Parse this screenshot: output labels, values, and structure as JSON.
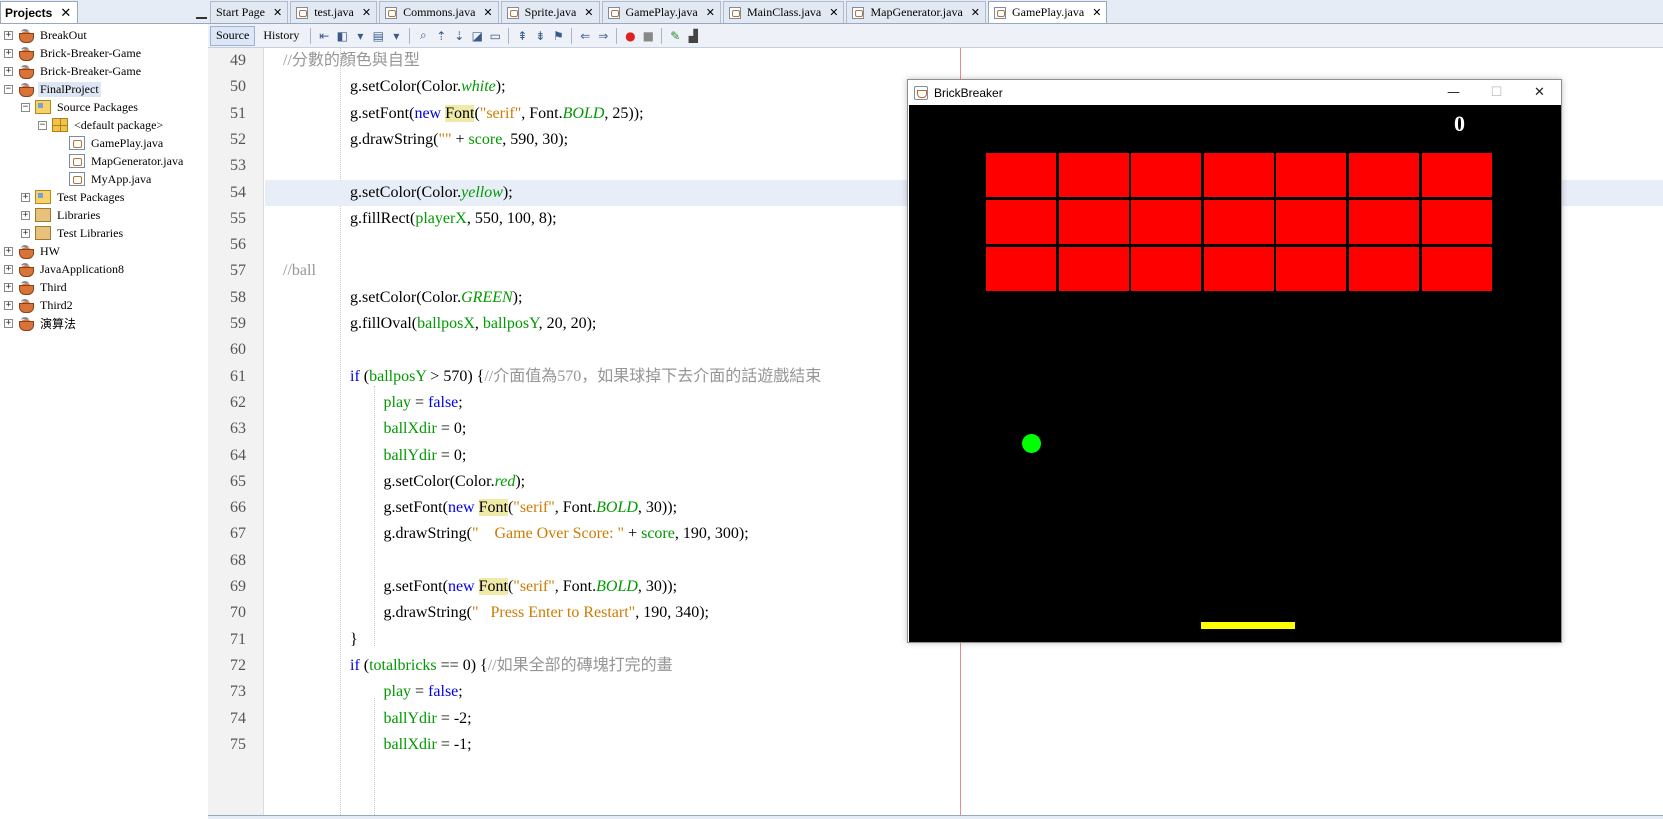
{
  "projects": {
    "tab_label": "Projects",
    "close_glyph": "✕",
    "nodes": [
      {
        "label": "BreakOut",
        "icon": "project-icon",
        "expander": "+"
      },
      {
        "label": "Brick-Breaker-Game",
        "icon": "project-icon",
        "expander": "+"
      },
      {
        "label": "Brick-Breaker-Game",
        "icon": "project-icon",
        "expander": "+"
      },
      {
        "label": "FinalProject",
        "icon": "project-icon",
        "expander": "−"
      },
      {
        "label": "Source Packages",
        "icon": "source-packages-icon",
        "expander": "−"
      },
      {
        "label": "<default package>",
        "icon": "package-icon",
        "expander": "−"
      },
      {
        "label": "GamePlay.java",
        "icon": "java-file-icon",
        "expander": ""
      },
      {
        "label": "MapGenerator.java",
        "icon": "java-file-icon",
        "expander": ""
      },
      {
        "label": "MyApp.java",
        "icon": "java-file-icon",
        "expander": ""
      },
      {
        "label": "Test Packages",
        "icon": "test-packages-icon",
        "expander": "+"
      },
      {
        "label": "Libraries",
        "icon": "libraries-icon",
        "expander": "+"
      },
      {
        "label": "Test Libraries",
        "icon": "test-libraries-icon",
        "expander": "+"
      },
      {
        "label": "HW",
        "icon": "project-icon",
        "expander": "+"
      },
      {
        "label": "JavaApplication8",
        "icon": "project-icon",
        "expander": "+"
      },
      {
        "label": "Third",
        "icon": "project-icon",
        "expander": "+"
      },
      {
        "label": "Third2",
        "icon": "project-icon",
        "expander": "+"
      },
      {
        "label": "演算法",
        "icon": "project-icon",
        "expander": "+"
      }
    ]
  },
  "editor": {
    "tabs": [
      {
        "label": "Start Page",
        "icon": ""
      },
      {
        "label": "test.java",
        "icon": "java-file-icon"
      },
      {
        "label": "Commons.java",
        "icon": "java-file-icon"
      },
      {
        "label": "Sprite.java",
        "icon": "java-file-icon"
      },
      {
        "label": "GamePlay.java",
        "icon": "java-file-icon"
      },
      {
        "label": "MainClass.java",
        "icon": "java-file-icon"
      },
      {
        "label": "MapGenerator.java",
        "icon": "java-file-icon"
      },
      {
        "label": "GamePlay.java",
        "icon": "java-file-icon"
      }
    ],
    "tab_close_glyph": "✕",
    "active_tab_index": 7,
    "toolbar": {
      "source_label": "Source",
      "history_label": "History"
    },
    "lines": [
      {
        "num": "49",
        "indent": 0,
        "segments": [
          {
            "t": "//分數的顏色與自型",
            "c": "cm"
          }
        ]
      },
      {
        "num": "50",
        "indent": 2,
        "segments": [
          {
            "t": "g.setColor(Color.",
            "c": "n"
          },
          {
            "t": "white",
            "c": "st"
          },
          {
            "t": ");",
            "c": "n"
          }
        ]
      },
      {
        "num": "51",
        "indent": 2,
        "segments": [
          {
            "t": "g.setFont(",
            "c": "n"
          },
          {
            "t": "new",
            "c": "kw"
          },
          {
            "t": " ",
            "c": "n"
          },
          {
            "t": "Font",
            "c": "hl"
          },
          {
            "t": "(",
            "c": "n"
          },
          {
            "t": "\"serif\"",
            "c": "s"
          },
          {
            "t": ", Font.",
            "c": "n"
          },
          {
            "t": "BOLD",
            "c": "st"
          },
          {
            "t": ", 25));",
            "c": "n"
          }
        ]
      },
      {
        "num": "52",
        "indent": 2,
        "segments": [
          {
            "t": "g.drawString(",
            "c": "n"
          },
          {
            "t": "\"\"",
            "c": "s"
          },
          {
            "t": " + ",
            "c": "n"
          },
          {
            "t": "score",
            "c": "f"
          },
          {
            "t": ", 590, 30);",
            "c": "n"
          }
        ]
      },
      {
        "num": "53",
        "indent": 0,
        "segments": []
      },
      {
        "num": "54",
        "indent": 2,
        "segments": [
          {
            "t": "g.setColor(Color.",
            "c": "n"
          },
          {
            "t": "yellow",
            "c": "st"
          },
          {
            "t": ");",
            "c": "n"
          }
        ],
        "current": true
      },
      {
        "num": "55",
        "indent": 2,
        "segments": [
          {
            "t": "g.fillRect(",
            "c": "n"
          },
          {
            "t": "playerX",
            "c": "f"
          },
          {
            "t": ", 550, 100, 8);",
            "c": "n"
          }
        ]
      },
      {
        "num": "56",
        "indent": 0,
        "segments": []
      },
      {
        "num": "57",
        "indent": 0,
        "segments": [
          {
            "t": "//ball",
            "c": "cm"
          }
        ]
      },
      {
        "num": "58",
        "indent": 2,
        "segments": [
          {
            "t": "g.setColor(Color.",
            "c": "n"
          },
          {
            "t": "GREEN",
            "c": "st"
          },
          {
            "t": ");",
            "c": "n"
          }
        ]
      },
      {
        "num": "59",
        "indent": 2,
        "segments": [
          {
            "t": "g.fillOval(",
            "c": "n"
          },
          {
            "t": "ballposX",
            "c": "f"
          },
          {
            "t": ", ",
            "c": "n"
          },
          {
            "t": "ballposY",
            "c": "f"
          },
          {
            "t": ", 20, 20);",
            "c": "n"
          }
        ]
      },
      {
        "num": "60",
        "indent": 0,
        "segments": []
      },
      {
        "num": "61",
        "indent": 2,
        "segments": [
          {
            "t": "if",
            "c": "kw"
          },
          {
            "t": " (",
            "c": "n"
          },
          {
            "t": "ballposY",
            "c": "f"
          },
          {
            "t": " > 570) {",
            "c": "n"
          },
          {
            "t": "//介面值為570，如果球掉下去介面的話遊戲結束",
            "c": "cm"
          }
        ]
      },
      {
        "num": "62",
        "indent": 3,
        "segments": [
          {
            "t": "play",
            "c": "f"
          },
          {
            "t": " = ",
            "c": "n"
          },
          {
            "t": "false",
            "c": "kw"
          },
          {
            "t": ";",
            "c": "n"
          }
        ]
      },
      {
        "num": "63",
        "indent": 3,
        "segments": [
          {
            "t": "ballXdir",
            "c": "f"
          },
          {
            "t": " = 0;",
            "c": "n"
          }
        ]
      },
      {
        "num": "64",
        "indent": 3,
        "segments": [
          {
            "t": "ballYdir",
            "c": "f"
          },
          {
            "t": " = 0;",
            "c": "n"
          }
        ]
      },
      {
        "num": "65",
        "indent": 3,
        "segments": [
          {
            "t": "g.setColor(Color.",
            "c": "n"
          },
          {
            "t": "red",
            "c": "st"
          },
          {
            "t": ");",
            "c": "n"
          }
        ]
      },
      {
        "num": "66",
        "indent": 3,
        "segments": [
          {
            "t": "g.setFont(",
            "c": "n"
          },
          {
            "t": "new",
            "c": "kw"
          },
          {
            "t": " ",
            "c": "n"
          },
          {
            "t": "Font",
            "c": "hl"
          },
          {
            "t": "(",
            "c": "n"
          },
          {
            "t": "\"serif\"",
            "c": "s"
          },
          {
            "t": ", Font.",
            "c": "n"
          },
          {
            "t": "BOLD",
            "c": "st"
          },
          {
            "t": ", 30));",
            "c": "n"
          }
        ]
      },
      {
        "num": "67",
        "indent": 3,
        "segments": [
          {
            "t": "g.drawString(",
            "c": "n"
          },
          {
            "t": "\"    Game Over Score: \"",
            "c": "s"
          },
          {
            "t": " + ",
            "c": "n"
          },
          {
            "t": "score",
            "c": "f"
          },
          {
            "t": ", 190, 300);",
            "c": "n"
          }
        ]
      },
      {
        "num": "68",
        "indent": 0,
        "segments": []
      },
      {
        "num": "69",
        "indent": 3,
        "segments": [
          {
            "t": "g.setFont(",
            "c": "n"
          },
          {
            "t": "new",
            "c": "kw"
          },
          {
            "t": " ",
            "c": "n"
          },
          {
            "t": "Font",
            "c": "hl"
          },
          {
            "t": "(",
            "c": "n"
          },
          {
            "t": "\"serif\"",
            "c": "s"
          },
          {
            "t": ", Font.",
            "c": "n"
          },
          {
            "t": "BOLD",
            "c": "st"
          },
          {
            "t": ", 30));",
            "c": "n"
          }
        ]
      },
      {
        "num": "70",
        "indent": 3,
        "segments": [
          {
            "t": "g.drawString(",
            "c": "n"
          },
          {
            "t": "\"   Press Enter to Restart\"",
            "c": "s"
          },
          {
            "t": ", 190, 340);",
            "c": "n"
          }
        ]
      },
      {
        "num": "71",
        "indent": 2,
        "segments": [
          {
            "t": "}",
            "c": "n"
          }
        ]
      },
      {
        "num": "72",
        "indent": 2,
        "segments": [
          {
            "t": "if",
            "c": "kw"
          },
          {
            "t": " (",
            "c": "n"
          },
          {
            "t": "totalbricks",
            "c": "f"
          },
          {
            "t": " == 0) {",
            "c": "n"
          },
          {
            "t": "//如果全部的磚塊打完的畫",
            "c": "cm"
          }
        ]
      },
      {
        "num": "73",
        "indent": 3,
        "segments": [
          {
            "t": "play",
            "c": "f"
          },
          {
            "t": " = ",
            "c": "n"
          },
          {
            "t": "false",
            "c": "kw"
          },
          {
            "t": ";",
            "c": "n"
          }
        ]
      },
      {
        "num": "74",
        "indent": 3,
        "segments": [
          {
            "t": "ballYdir",
            "c": "f"
          },
          {
            "t": " = -2;",
            "c": "n"
          }
        ]
      },
      {
        "num": "75",
        "indent": 3,
        "segments": [
          {
            "t": "ballXdir",
            "c": "f"
          },
          {
            "t": " = -1;",
            "c": "n"
          }
        ]
      }
    ]
  },
  "colors": {
    "keyword": "#0000e6",
    "string": "#ce7b00",
    "field": "#009900",
    "static": "#009900",
    "comment": "#969696",
    "highlight_bg": "#f0eaa8",
    "brick": "#ff0000",
    "ball": "#00ff00",
    "paddle": "#ffff00"
  },
  "game": {
    "window_title": "BrickBreaker",
    "score": "0",
    "minimize_glyph": "—",
    "maximize_glyph": "☐",
    "close_glyph": "✕",
    "brick_rows": 3,
    "brick_cols": 7
  }
}
